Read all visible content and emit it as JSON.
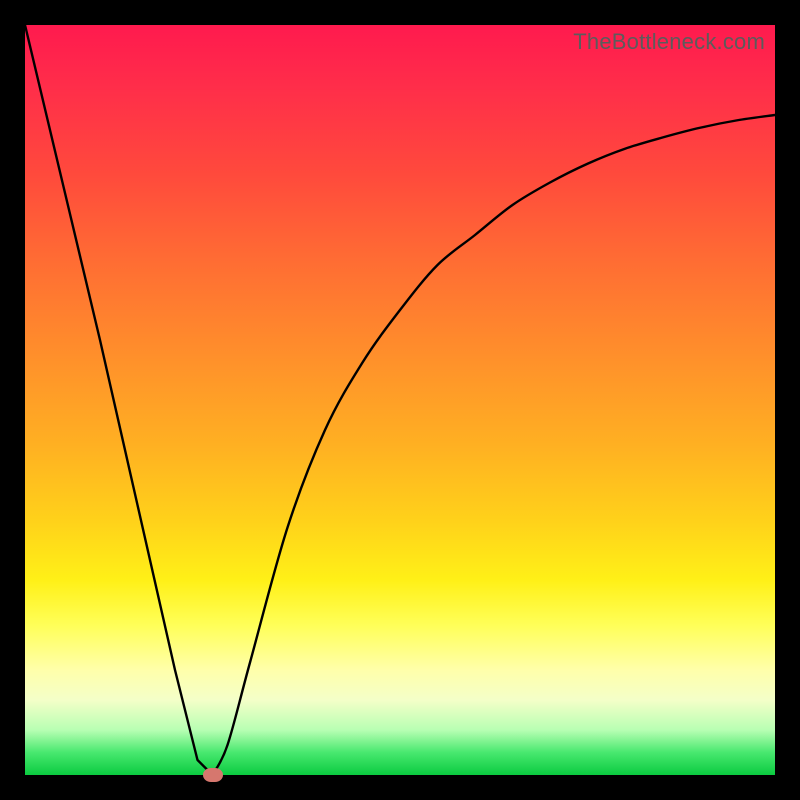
{
  "watermark": "TheBottleneck.com",
  "chart_data": {
    "type": "line",
    "title": "",
    "xlabel": "",
    "ylabel": "",
    "xlim": [
      0,
      100
    ],
    "ylim": [
      0,
      100
    ],
    "grid": false,
    "legend": false,
    "series": [
      {
        "name": "bottleneck-curve",
        "x": [
          0,
          5,
          10,
          15,
          20,
          23,
          25,
          27,
          30,
          35,
          40,
          45,
          50,
          55,
          60,
          65,
          70,
          75,
          80,
          85,
          90,
          95,
          100
        ],
        "y": [
          100,
          79,
          58,
          36,
          14,
          2,
          0,
          4,
          15,
          33,
          46,
          55,
          62,
          68,
          72,
          76,
          79,
          81.5,
          83.5,
          85,
          86.3,
          87.3,
          88
        ]
      }
    ],
    "marker": {
      "x": 25,
      "y": 0,
      "color": "#d6776e"
    },
    "background_gradient": {
      "top": "#ff1a4e",
      "bottom": "#0bcb40"
    },
    "curve_color": "#000000"
  }
}
